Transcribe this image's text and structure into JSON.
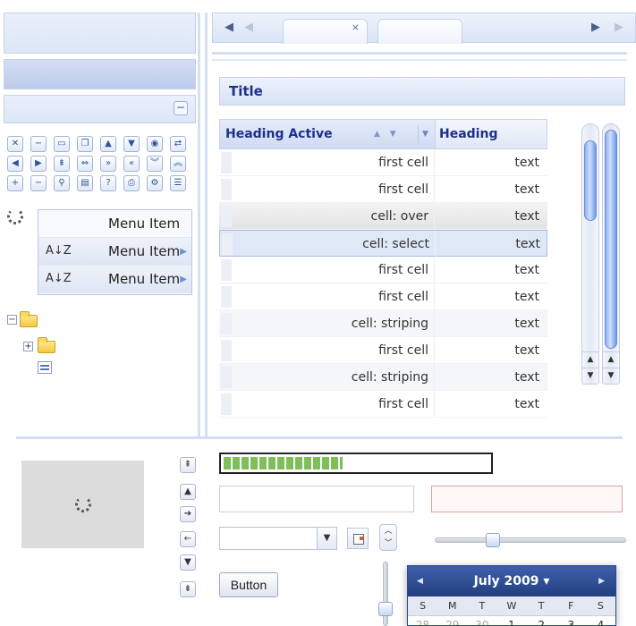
{
  "toolbar_icons": [
    {
      "name": "close-icon",
      "glyph": "✕"
    },
    {
      "name": "minimize-icon",
      "glyph": "−"
    },
    {
      "name": "maximize-icon",
      "glyph": "▭"
    },
    {
      "name": "restore-icon",
      "glyph": "❐"
    },
    {
      "name": "collapse-up-icon",
      "glyph": "▲"
    },
    {
      "name": "expand-down-icon",
      "glyph": "▼"
    },
    {
      "name": "globe-icon",
      "glyph": "◉"
    },
    {
      "name": "refresh-icon",
      "glyph": "⇄"
    },
    {
      "name": "left-icon",
      "glyph": "◀"
    },
    {
      "name": "right-icon",
      "glyph": "▶"
    },
    {
      "name": "pin-icon",
      "glyph": "⇟"
    },
    {
      "name": "unpin-icon",
      "glyph": "⇔"
    },
    {
      "name": "double-right-icon",
      "glyph": "»"
    },
    {
      "name": "double-left-icon",
      "glyph": "«"
    },
    {
      "name": "double-down-icon",
      "glyph": "︾"
    },
    {
      "name": "double-up-icon",
      "glyph": "︽"
    },
    {
      "name": "plus-icon",
      "glyph": "+"
    },
    {
      "name": "minus-icon",
      "glyph": "−"
    },
    {
      "name": "search-icon",
      "glyph": "⚲"
    },
    {
      "name": "save-icon",
      "glyph": "▤"
    },
    {
      "name": "help-icon",
      "glyph": "?"
    },
    {
      "name": "print-icon",
      "glyph": "⎙"
    },
    {
      "name": "gear-icon",
      "glyph": "⚙"
    },
    {
      "name": "list-icon",
      "glyph": "☰"
    }
  ],
  "menu": {
    "items": [
      {
        "label": "Menu Item",
        "sort_glyph": "",
        "has_submenu": false
      },
      {
        "label": "Menu Item",
        "sort_glyph": "A↓Z",
        "has_submenu": true
      },
      {
        "label": "Menu Item",
        "sort_glyph": "A↓Z",
        "has_submenu": true
      }
    ]
  },
  "tabs": {
    "nav_left": "◀",
    "nav_left_dim": "◀",
    "nav_right": "▶",
    "nav_right_dim": "▶",
    "close_glyph": "×"
  },
  "panel": {
    "title": "Title"
  },
  "grid": {
    "headers": [
      "Heading Active",
      "Heading"
    ],
    "sort_arrows": "▲ ▼",
    "dropdown_glyph": "▼",
    "rows": [
      {
        "c1": "first cell",
        "c2": "text",
        "state": "normal"
      },
      {
        "c1": "first cell",
        "c2": "text",
        "state": "normal"
      },
      {
        "c1": "cell: over",
        "c2": "text",
        "state": "over"
      },
      {
        "c1": "cell: select",
        "c2": "text",
        "state": "select"
      },
      {
        "c1": "first cell",
        "c2": "text",
        "state": "normal"
      },
      {
        "c1": "first cell",
        "c2": "text",
        "state": "normal"
      },
      {
        "c1": "cell: striping",
        "c2": "text",
        "state": "stripe"
      },
      {
        "c1": "first cell",
        "c2": "text",
        "state": "normal"
      },
      {
        "c1": "cell: striping",
        "c2": "text",
        "state": "stripe"
      },
      {
        "c1": "first cell",
        "c2": "text",
        "state": "normal"
      }
    ]
  },
  "scroll": {
    "up_glyph": "▲",
    "down_glyph": "▼"
  },
  "vertical_buttons": [
    "⇞",
    "▲",
    "➔",
    "←",
    "▼",
    "⇟"
  ],
  "progress": {
    "value": 0.45
  },
  "combo": {
    "trigger_glyph": "▼",
    "value": ""
  },
  "spinner_glyphs": {
    "up": "︿",
    "down": "﹀"
  },
  "button": {
    "label": "Button"
  },
  "calendar": {
    "month": "July 2009 ▾",
    "prev": "◀",
    "next": "▶",
    "weekdays": [
      "S",
      "M",
      "T",
      "W",
      "T",
      "F",
      "S"
    ],
    "first_row": [
      {
        "d": "28",
        "other": true
      },
      {
        "d": "29",
        "other": true
      },
      {
        "d": "30",
        "other": true
      },
      {
        "d": "1",
        "other": false
      },
      {
        "d": "2",
        "other": false
      },
      {
        "d": "3",
        "other": false
      },
      {
        "d": "4",
        "other": false
      }
    ]
  },
  "colors": {
    "accent": "#1e2f8a",
    "calendar_header": "#2d4b92",
    "progress_fill": "#7fbf5a",
    "invalid_border": "#e0a0a0"
  }
}
